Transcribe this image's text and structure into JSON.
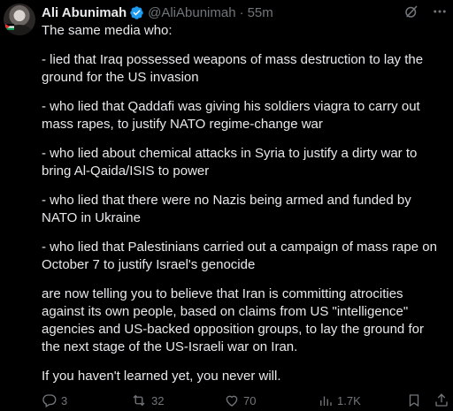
{
  "author": {
    "name": "Ali Abunimah",
    "handle": "@AliAbunimah",
    "separator": "·",
    "time": "55m"
  },
  "tweet": {
    "paragraphs": [
      "The same media who:",
      "- lied that Iraq possessed weapons of mass destruction to lay the ground for the US invasion",
      "- who lied that Qaddafi was giving his soldiers viagra to carry out mass rapes, to justify NATO regime-change war",
      "- who lied about chemical attacks in Syria to justify a dirty war to bring Al-Qaida/ISIS to power",
      "- who lied that there were no Nazis being armed and funded by NATO in Ukraine",
      "- who lied that Palestinians carried out a campaign of mass rape on October 7 to justify Israel's genocide",
      "are now telling you to believe that Iran is committing atrocities against its own people, based on claims from US \"intelligence\" agencies and US-backed opposition groups, to lay the ground for the next stage of the US-Israeli war on Iran.",
      "If you haven't learned yet, you never will."
    ]
  },
  "actions": {
    "replies": "3",
    "reposts": "32",
    "likes": "70",
    "views": "1.7K"
  },
  "icons": {
    "verified": "verified-badge-icon",
    "grok": "grok-icon",
    "more": "more-icon",
    "reply": "reply-icon",
    "repost": "repost-icon",
    "like": "heart-icon",
    "views": "views-icon",
    "bookmark": "bookmark-icon",
    "share": "share-icon"
  },
  "colors": {
    "background": "#000000",
    "text": "#e7e9ea",
    "secondary": "#71767b",
    "verified": "#1d9bf0"
  }
}
